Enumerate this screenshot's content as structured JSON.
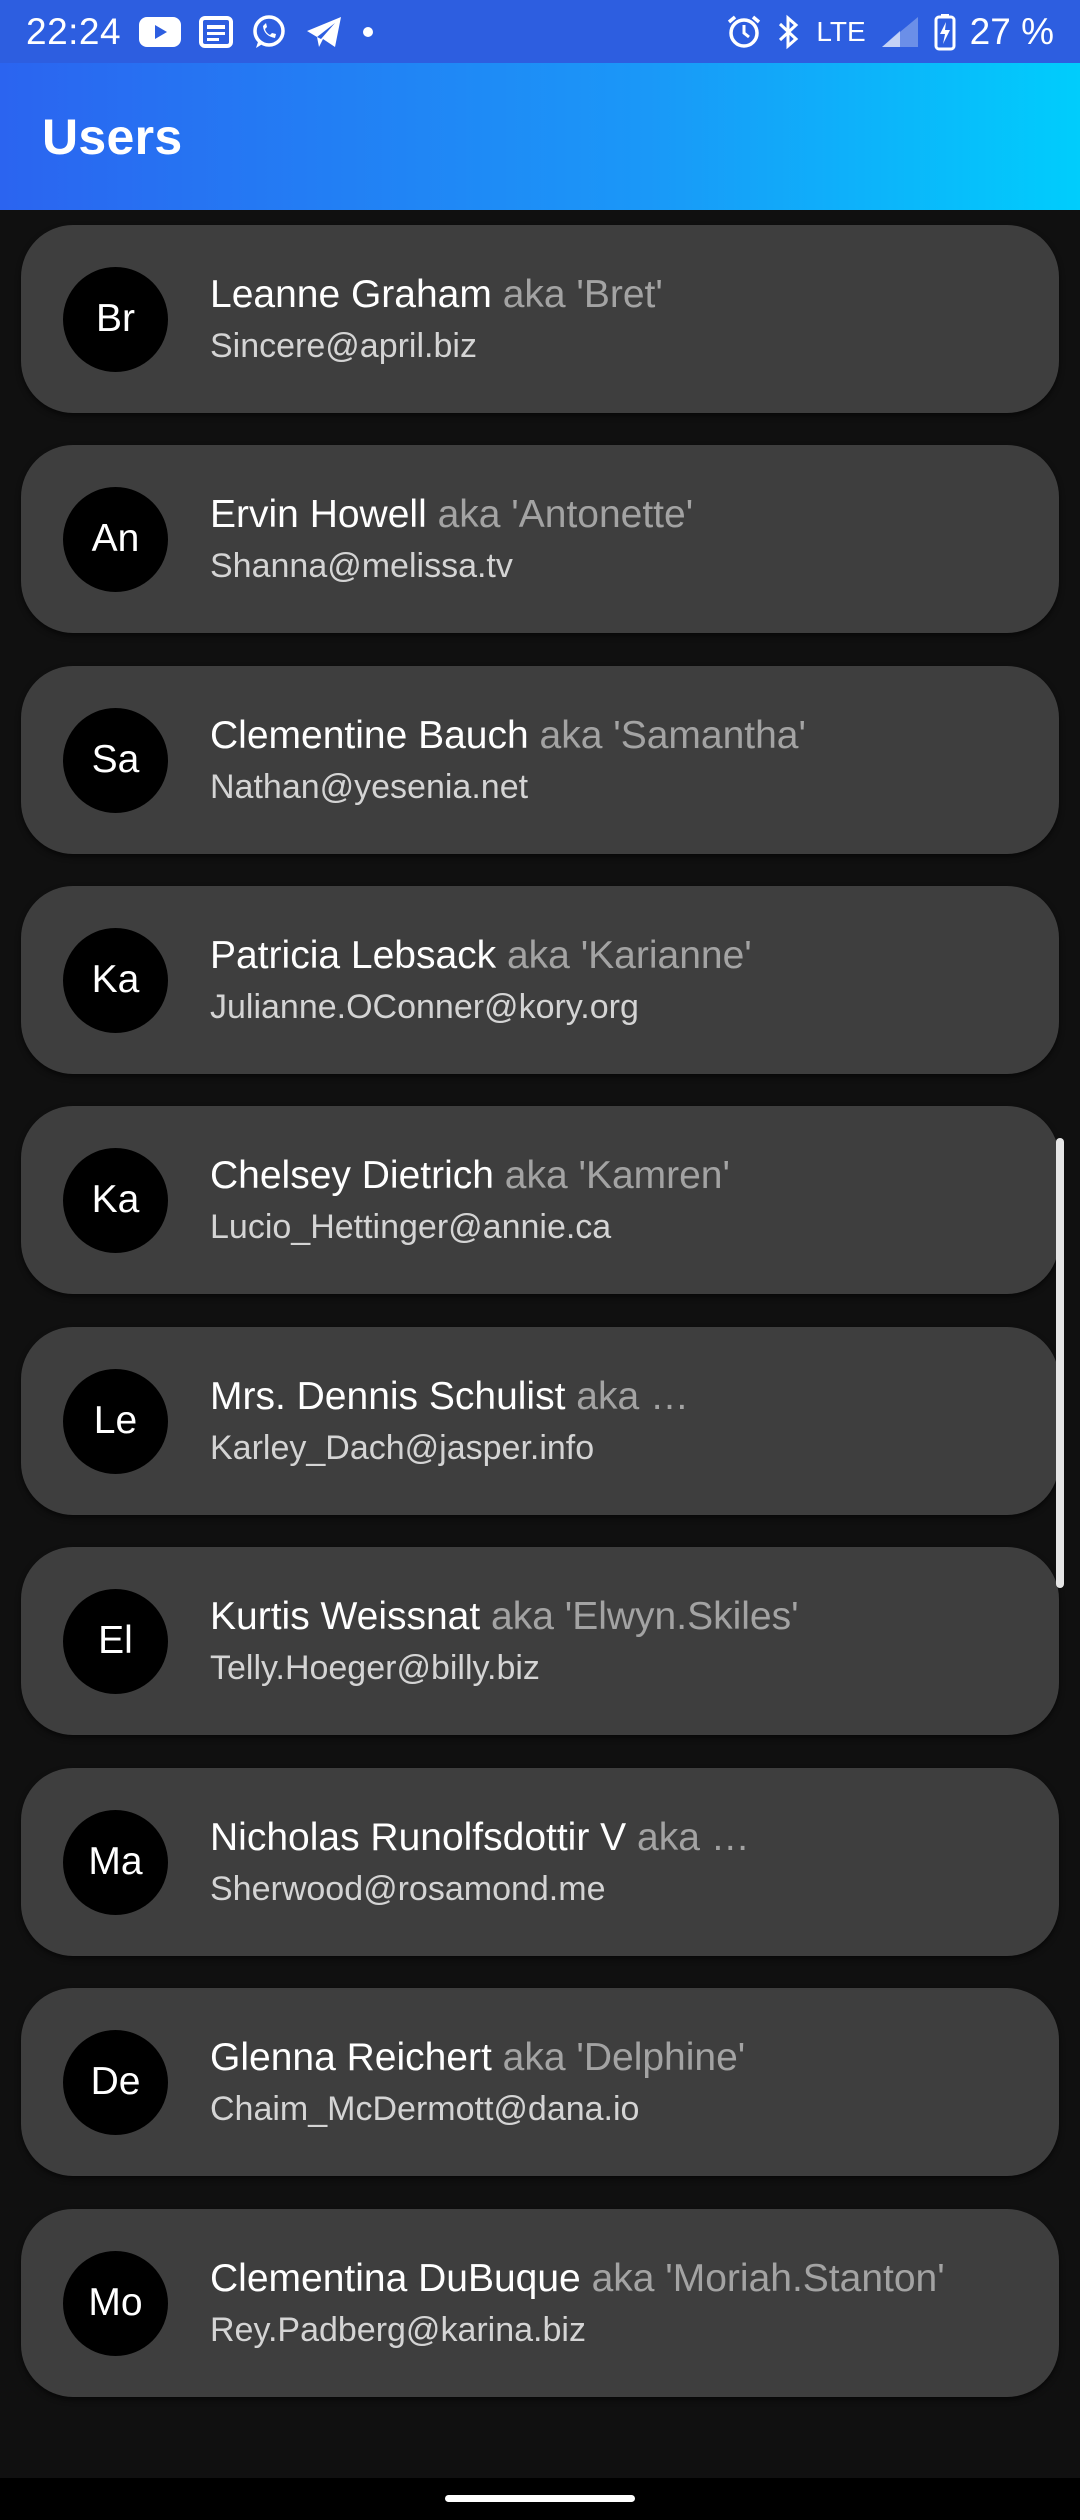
{
  "status_bar": {
    "time": "22:24",
    "network": "LTE",
    "battery": "27 %",
    "left_icons": [
      "youtube-icon",
      "news-icon",
      "whatsapp-icon",
      "telegram-icon",
      "dot-icon"
    ],
    "right_icons": [
      "alarm-icon",
      "bluetooth-icon",
      "signal-icon",
      "battery-charging-icon"
    ]
  },
  "app_bar": {
    "title": "Users"
  },
  "users": [
    {
      "initials": "Br",
      "name": "Leanne Graham",
      "aka": "aka 'Bret'",
      "email": "Sincere@april.biz"
    },
    {
      "initials": "An",
      "name": "Ervin Howell",
      "aka": "aka 'Antonette'",
      "email": "Shanna@melissa.tv"
    },
    {
      "initials": "Sa",
      "name": "Clementine Bauch",
      "aka": "aka 'Samantha'",
      "email": "Nathan@yesenia.net"
    },
    {
      "initials": "Ka",
      "name": "Patricia Lebsack",
      "aka": "aka 'Karianne'",
      "email": "Julianne.OConner@kory.org"
    },
    {
      "initials": "Ka",
      "name": "Chelsey Dietrich",
      "aka": "aka 'Kamren'",
      "email": "Lucio_Hettinger@annie.ca"
    },
    {
      "initials": "Le",
      "name": "Mrs. Dennis Schulist",
      "aka": "aka …",
      "email": "Karley_Dach@jasper.info"
    },
    {
      "initials": "El",
      "name": "Kurtis Weissnat",
      "aka": "aka 'Elwyn.Skiles'",
      "email": "Telly.Hoeger@billy.biz"
    },
    {
      "initials": "Ma",
      "name": "Nicholas Runolfsdottir V",
      "aka": "aka …",
      "email": "Sherwood@rosamond.me"
    },
    {
      "initials": "De",
      "name": "Glenna Reichert",
      "aka": "aka 'Delphine'",
      "email": "Chaim_McDermott@dana.io"
    },
    {
      "initials": "Mo",
      "name": "Clementina DuBuque",
      "aka": "aka 'Moriah.Stanton'",
      "email": "Rey.Padberg@karina.biz"
    }
  ],
  "colors": {
    "background": "#101010",
    "card": "#3e3e3e",
    "avatar": "#000000",
    "aka_text": "#a3a3a3",
    "email_text": "#d4d4d4",
    "app_bar_start": "#2b64f0",
    "app_bar_end": "#00cdfc"
  }
}
